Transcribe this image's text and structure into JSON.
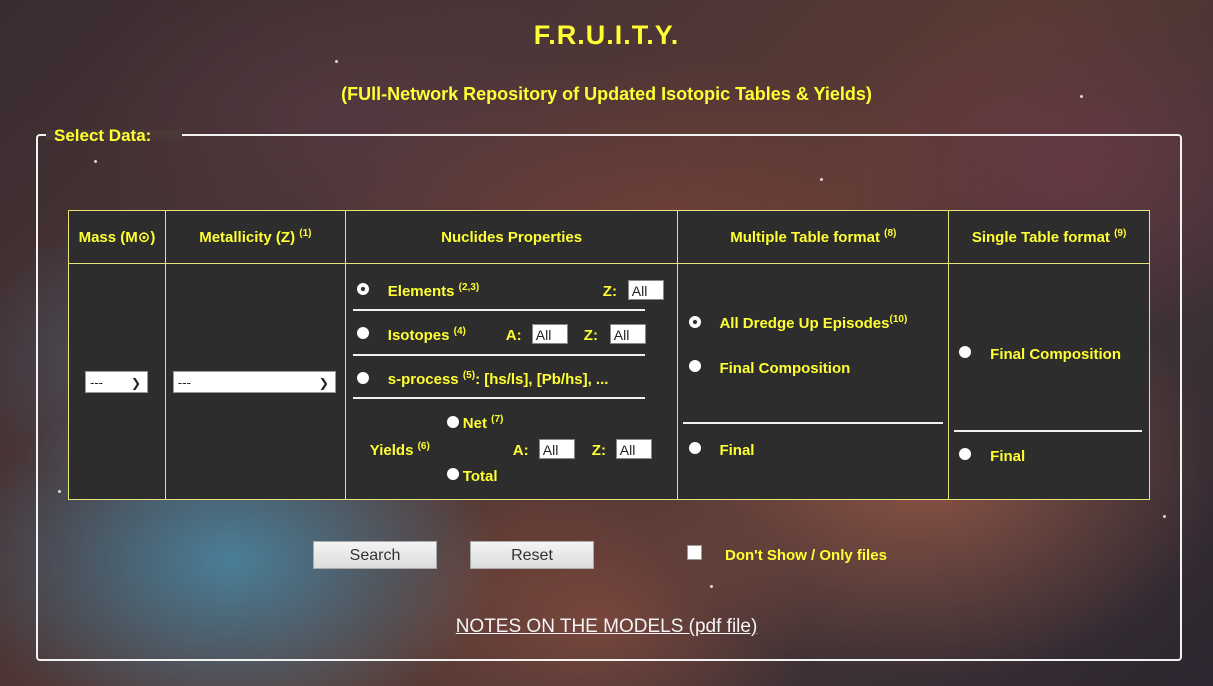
{
  "header": {
    "title": "F.R.U.I.T.Y.",
    "subtitle": "(FUll-Network Repository of Updated Isotopic Tables & Yields)"
  },
  "form": {
    "legend": "Select Data:",
    "columns": {
      "mass": "Mass (M⊙)",
      "metallicity": "Metallicity (Z)",
      "metallicity_note": "(1)",
      "nuclides": "Nuclides Properties",
      "multiple": "Multiple Table format",
      "multiple_note": "(8)",
      "single": "Single Table format",
      "single_note": "(9)"
    },
    "mass_select": "---",
    "metallicity_select": "---",
    "nuclides": {
      "elements_label": "Elements",
      "elements_note": "(2,3)",
      "z_label": "Z:",
      "a_label": "A:",
      "isotopes_label": "Isotopes",
      "isotopes_note": "(4)",
      "sprocess_label": "s-process",
      "sprocess_note": "(5)",
      "sprocess_desc": ": [hs/ls], [Pb/hs], ...",
      "yields_label": "Yields",
      "yields_note": "(6)",
      "net_label": "Net",
      "net_note": "(7)",
      "total_label": "Total",
      "all_value": "All"
    },
    "multiple": {
      "all_dredge": "All Dredge Up Episodes",
      "all_dredge_note": "(10)",
      "final_composition": "Final Composition",
      "final": "Final"
    },
    "single": {
      "final_composition": "Final Composition",
      "final": "Final"
    },
    "buttons": {
      "search": "Search",
      "reset": "Reset"
    },
    "checkbox_label": "Don't Show / Only files"
  },
  "footer": {
    "notes_link": "NOTES ON THE MODELS (pdf file)"
  }
}
